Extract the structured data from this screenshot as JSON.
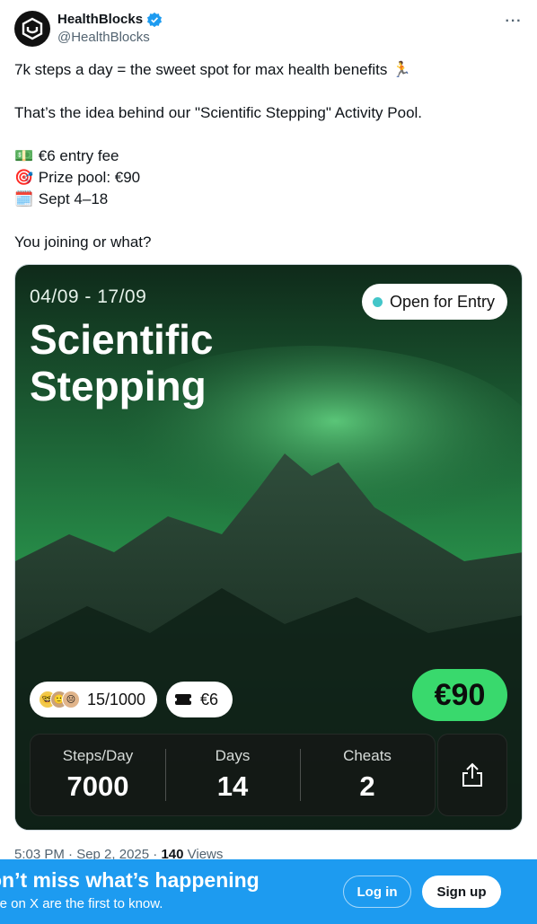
{
  "author": {
    "name": "HealthBlocks",
    "handle": "@HealthBlocks",
    "verified": true
  },
  "tweet": {
    "line1": "7k steps a day = the sweet spot for max health benefits",
    "line1_emoji": "🏃",
    "line2": "That’s the idea behind our \"Scientific Stepping\" Activity Pool.",
    "fee_emoji": "💵",
    "fee": "€6 entry fee",
    "prize_emoji": "🎯",
    "prize": "Prize pool: €90",
    "date_emoji": "🗓️",
    "dates": "Sept 4–18",
    "closing": "You joining or what?"
  },
  "card": {
    "date_range": "04/09 - 17/09",
    "title_line1": "Scientific",
    "title_line2": "Stepping",
    "status": "Open for Entry",
    "participants": "15/1000",
    "entry_fee": "€6",
    "prize": "€90",
    "stats": [
      {
        "label": "Steps/Day",
        "value": "7000"
      },
      {
        "label": "Days",
        "value": "14"
      },
      {
        "label": "Cheats",
        "value": "2"
      }
    ]
  },
  "meta": {
    "time": "5:03 PM · Sep 2, 2025 · ",
    "views_count": "140",
    "views_label": "Views"
  },
  "banner": {
    "title": "on’t miss what’s happening",
    "subtitle": "ple on X are the first to know.",
    "login": "Log in",
    "signup": "Sign up"
  },
  "colors": {
    "brand_blue": "#1d9bf0",
    "prize_green": "#39d96d",
    "status_dot": "#43c6c9"
  }
}
